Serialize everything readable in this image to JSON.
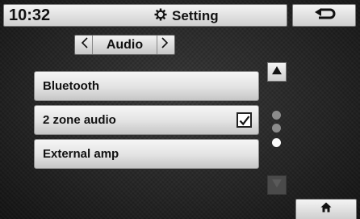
{
  "header": {
    "time": "10:32",
    "title": "Setting",
    "title_icon": "gear-icon",
    "back_icon": "back-arrow-icon"
  },
  "category": {
    "label": "Audio",
    "prev_icon": "chevron-left-icon",
    "next_icon": "chevron-right-icon"
  },
  "items": [
    {
      "label": "Bluetooth"
    },
    {
      "label": "2 zone audio",
      "checked": true
    },
    {
      "label": "External amp"
    }
  ],
  "pager": {
    "pages": 3,
    "current_page": 3,
    "up_enabled": true,
    "down_enabled": false
  },
  "footer": {
    "home_icon": "home-icon"
  }
}
